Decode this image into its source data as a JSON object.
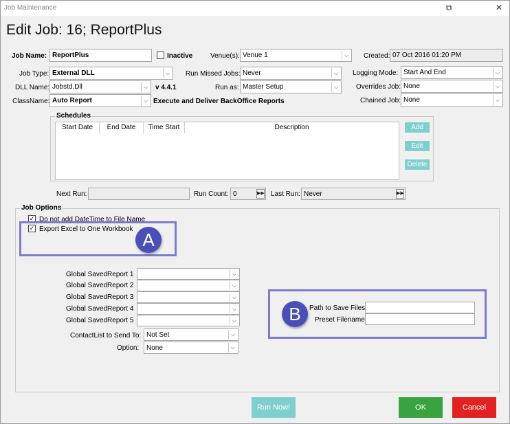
{
  "window": {
    "title": "Job Maintenance"
  },
  "header": {
    "title": "Edit Job: 16; ReportPlus"
  },
  "form": {
    "job_name_label": "Job Name:",
    "job_name_value": "ReportPlus",
    "inactive_label": "Inactive",
    "venues_label": "Venue(s):",
    "venues_value": "Venue 1",
    "created_label": "Created:",
    "created_value": "07 Oct 2016 01:20 PM",
    "job_type_label": "Job Type:",
    "job_type_value": "External DLL",
    "run_missed_label": "Run Missed Jobs:",
    "run_missed_value": "Never",
    "logging_mode_label": "Logging Mode:",
    "logging_mode_value": "Start And End",
    "dll_name_label": "DLL Name:",
    "dll_name_value": "Jobstd.Dll",
    "version": "v 4.4.1",
    "run_as_label": "Run as:",
    "run_as_value": "Master Setup",
    "overrides_label": "Overrides Job:",
    "overrides_value": "None",
    "classname_label": "ClassName:",
    "classname_value": "Auto Report",
    "class_description": "Execute and Deliver BackOffice Reports",
    "chained_label": "Chained Job:",
    "chained_value": "None"
  },
  "schedules": {
    "title": "Schedules",
    "columns": [
      "Start Date",
      "End Date",
      "Time Start",
      "Description"
    ],
    "add_label": "Add",
    "edit_label": "Edit",
    "delete_label": "Delete"
  },
  "run_info": {
    "next_run_label": "Next Run:",
    "next_run_value": "",
    "run_count_label": "Run Count:",
    "run_count_value": "0",
    "last_run_label": "Last Run:",
    "last_run_value": "Never"
  },
  "job_options": {
    "title": "Job Options",
    "opt1_label": "Do not add DateTime to File Name",
    "opt2_label": "Export Excel to One Workbook",
    "saved_reports": [
      {
        "label": "Global SavedReport 1",
        "value": ""
      },
      {
        "label": "Global SavedReport 2",
        "value": ""
      },
      {
        "label": "Global SavedReport 3",
        "value": ""
      },
      {
        "label": "Global SavedReport 4",
        "value": ""
      },
      {
        "label": "Global SavedReport 5",
        "value": ""
      }
    ],
    "contact_label": "ContactList to Send To:",
    "contact_value": "Not Set",
    "option_label": "Option:",
    "option_value": "None",
    "path_label": "Path to Save Files",
    "path_value": "",
    "preset_label": "Preset Filename",
    "preset_value": ""
  },
  "callouts": {
    "a": "A",
    "b": "B"
  },
  "footer": {
    "run_now": "Run Now!",
    "ok": "OK",
    "cancel": "Cancel"
  },
  "icons": {
    "dropdown": "chevron-down-icon",
    "fast_forward": "fast-forward-icon",
    "check": "check-icon",
    "restore": "restore-icon",
    "close": "close-icon"
  },
  "colors": {
    "ok": "#3aa33f",
    "cancel": "#e02222",
    "run_now": "#7fcfcf",
    "schedule_buttons": "#7fcfcf",
    "callout": "#4a4fb8"
  }
}
